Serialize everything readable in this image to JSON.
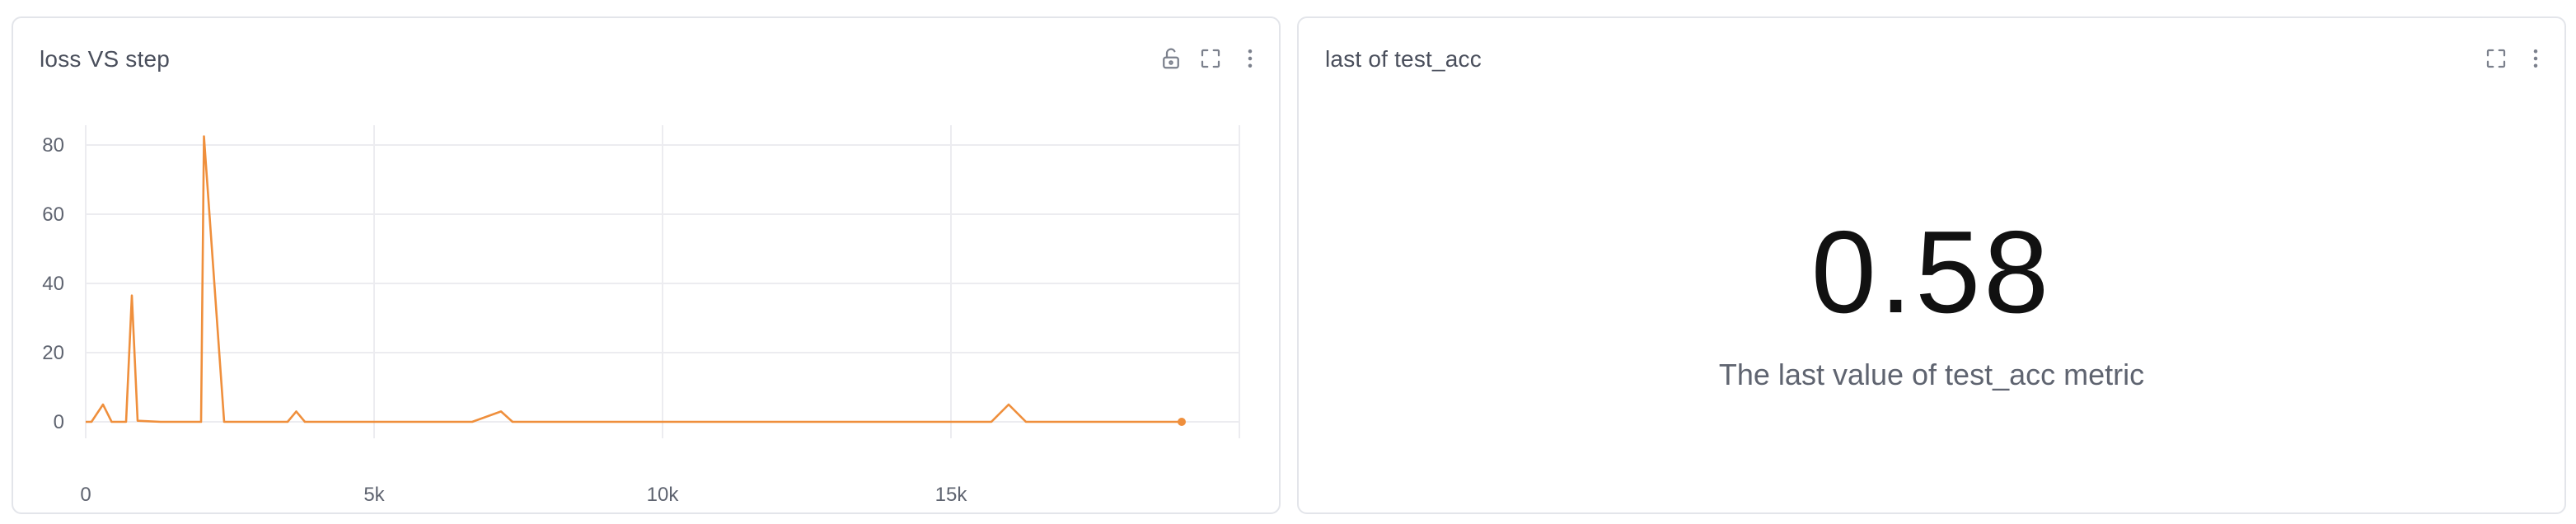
{
  "panels": {
    "left": {
      "title": "loss VS step"
    },
    "right": {
      "title": "last of test_acc",
      "value": "0.58",
      "caption": "The last value of test_acc metric"
    }
  },
  "icons": {
    "left_actions": [
      "lock-open-icon",
      "fullscreen-icon",
      "more-vertical-icon"
    ],
    "right_actions": [
      "fullscreen-icon",
      "more-vertical-icon"
    ]
  },
  "colors": {
    "series": "#ef8f3c",
    "grid": "#ececf0",
    "border": "#e3e5ea"
  },
  "chart_data": {
    "type": "line",
    "title": "loss VS step",
    "xlabel": "",
    "ylabel": "",
    "xlim": [
      0,
      20000
    ],
    "ylim": [
      0,
      85
    ],
    "x_ticks": [
      0,
      5000,
      10000,
      15000
    ],
    "x_tick_labels": [
      "0",
      "5k",
      "10k",
      "15k"
    ],
    "y_ticks": [
      0,
      20,
      40,
      60,
      80
    ],
    "y_tick_labels": [
      "0",
      "20",
      "40",
      "60",
      "80"
    ],
    "grid": true,
    "legend": "none",
    "series": [
      {
        "values": [
          [
            0,
            0
          ],
          [
            100,
            0
          ],
          [
            300,
            5
          ],
          [
            450,
            0
          ],
          [
            700,
            0
          ],
          [
            800,
            36.5
          ],
          [
            900,
            0.3
          ],
          [
            1300,
            0
          ],
          [
            1800,
            0
          ],
          [
            2000,
            0
          ],
          [
            2050,
            82.5
          ],
          [
            2400,
            0
          ],
          [
            2800,
            0
          ],
          [
            3300,
            0
          ],
          [
            3500,
            0
          ],
          [
            3650,
            3
          ],
          [
            3800,
            0
          ],
          [
            6700,
            0
          ],
          [
            7200,
            3
          ],
          [
            7400,
            0
          ],
          [
            15700,
            0
          ],
          [
            16000,
            5
          ],
          [
            16300,
            0
          ],
          [
            19000,
            0
          ]
        ]
      }
    ]
  }
}
